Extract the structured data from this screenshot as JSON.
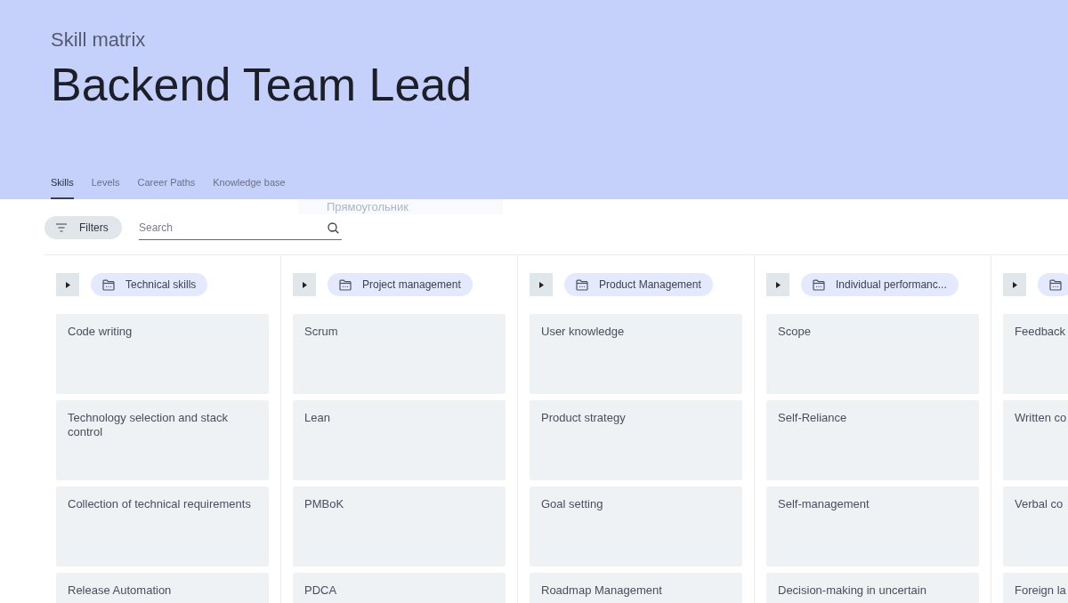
{
  "header": {
    "subtitle": "Skill matrix",
    "title": "Backend Team Lead"
  },
  "tabs": [
    {
      "label": "Skills",
      "selected": true
    },
    {
      "label": "Levels",
      "selected": false
    },
    {
      "label": "Career Paths",
      "selected": false
    },
    {
      "label": "Knowledge base",
      "selected": false
    }
  ],
  "ghost_label": "Прямоугольник",
  "filters_button": "Filters",
  "search": {
    "placeholder": "Search"
  },
  "columns": [
    {
      "category": "Technical skills",
      "skills": [
        "Code writing",
        "Technology selection and stack control",
        "Collection of technical requirements",
        "Release Automation"
      ]
    },
    {
      "category": "Project management",
      "skills": [
        "Scrum",
        "Lean",
        "PMBoK",
        "PDCA"
      ]
    },
    {
      "category": "Product Management",
      "skills": [
        "User knowledge",
        "Product strategy",
        "Goal setting",
        "Roadmap Management"
      ]
    },
    {
      "category": "Individual performanc...",
      "skills": [
        "Scope",
        "Self-Reliance",
        "Self-management",
        "Decision-making in uncertain"
      ]
    },
    {
      "skills": [
        "Feedback",
        "Written co",
        "Verbal co",
        "Foreign la"
      ]
    }
  ]
}
